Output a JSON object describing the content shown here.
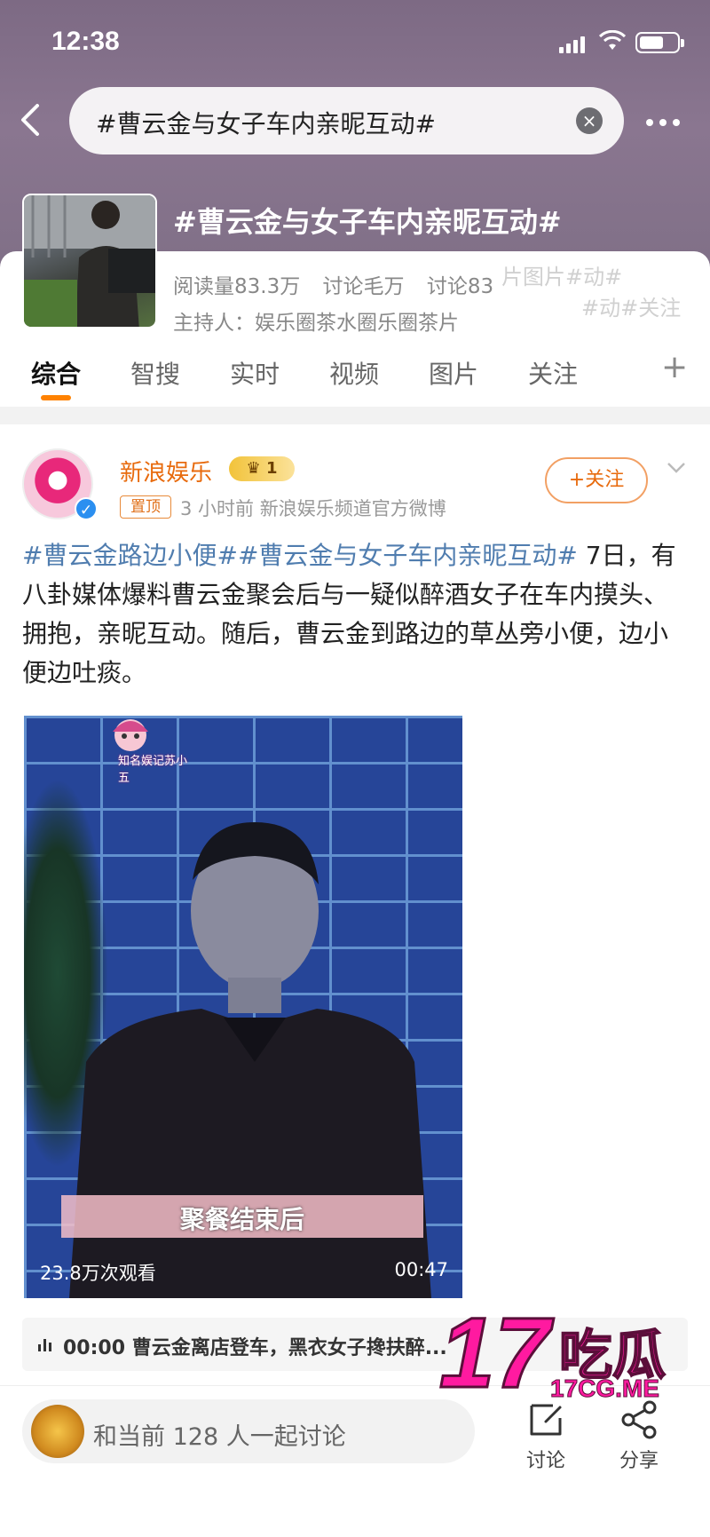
{
  "status_bar": {
    "time": "12:38",
    "battery_level": 0.65
  },
  "search": {
    "query": "#曹云金与女子车内亲昵互动#"
  },
  "topic": {
    "title": "#曹云金与女子车内亲昵互动#",
    "stats": [
      "阅读量83.3万",
      "讨论毛万",
      "讨论83"
    ],
    "host": "主持人：娱乐圈茶水圈乐圈茶片",
    "glitch_text_1": "片图片#动#",
    "glitch_text_2": "#动#关注"
  },
  "tabs": [
    {
      "label": "综合",
      "active": true
    },
    {
      "label": "智搜",
      "active": false
    },
    {
      "label": "实时",
      "active": false
    },
    {
      "label": "视频",
      "active": false
    },
    {
      "label": "图片",
      "active": false
    },
    {
      "label": "关注",
      "active": false
    }
  ],
  "post": {
    "author": "新浪娱乐",
    "crown_level": "1",
    "pin_label": "置顶",
    "meta": "3 小时前  新浪娱乐频道官方微博",
    "follow_label": "+关注",
    "hashtag_1": "#曹云金路边小便#",
    "hashtag_2": "#曹云金与女子车内亲昵互动#",
    "body": " 7日，有八卦媒体爆料曹云金聚会后与一疑似醉酒女子在车内摸头、拥抱，亲昵互动。随后，曹云金到路边的草丛旁小便，边小便边吐痰。"
  },
  "video": {
    "sticker_text": "知名娱记苏小五",
    "subtitle": "聚餐结束后",
    "views": "23.8万次观看",
    "duration": "00:47"
  },
  "chapter": {
    "text": "00:00 曹云金离店登车，黑衣女子搀扶醉..."
  },
  "footer": {
    "discuss_prompt": "和当前 128 人一起讨论",
    "actions": [
      {
        "label": "讨论"
      },
      {
        "label": "分享"
      }
    ]
  },
  "watermark": {
    "number": "17",
    "cn": "吃瓜",
    "url": "17CG.ME"
  },
  "colors": {
    "accent": "#ff8200",
    "hashtag": "#507daf",
    "author": "#e86b0e",
    "watermark": "#ff1aa0"
  },
  "icons": [
    "back-icon",
    "clear-icon",
    "more-icon",
    "plus-icon",
    "chevron-down-icon",
    "verified-icon",
    "crown-icon",
    "audio-bars-icon",
    "comment-icon",
    "share-icon"
  ]
}
